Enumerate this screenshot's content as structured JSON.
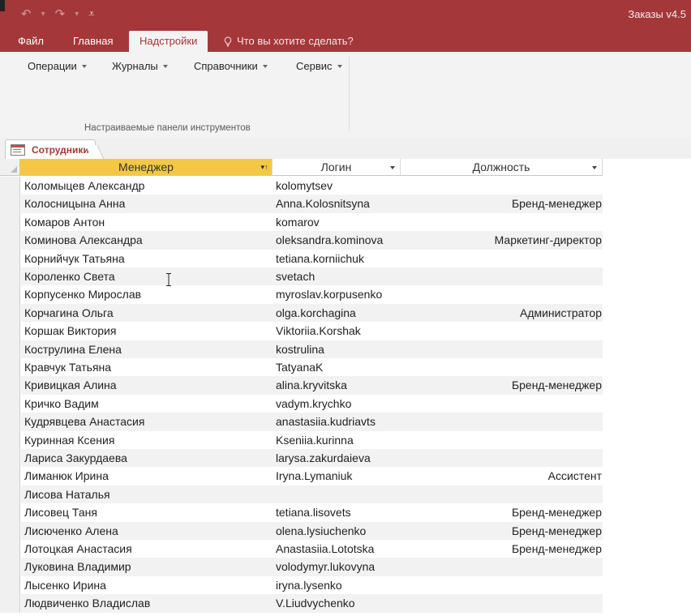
{
  "window": {
    "title": "Заказы v4.5"
  },
  "ribbon": {
    "tabs": [
      {
        "label": "Файл",
        "active": false
      },
      {
        "label": "Главная",
        "active": false
      },
      {
        "label": "Надстройки",
        "active": true
      }
    ],
    "tell_me": "Что вы хотите сделать?",
    "buttons": [
      "Операции",
      "Журналы",
      "Справочники",
      "Сервис"
    ],
    "group_label": "Настраиваемые панели инструментов"
  },
  "document_tab": {
    "label": "Сотрудники"
  },
  "table": {
    "columns": [
      "Менеджер",
      "Логин",
      "Должность"
    ],
    "sorted_column": "Менеджер",
    "rows": [
      [
        "Коломыцев  Александр",
        "kolomytsev",
        ""
      ],
      [
        "Колосницына Анна",
        "Anna.Kolosnitsyna",
        "Бренд-менеджер"
      ],
      [
        "Комаров Антон",
        "komarov",
        ""
      ],
      [
        "Коминова Александра",
        "oleksandra.kominova",
        "Маркетинг-директор"
      ],
      [
        "Корнийчук Татьяна",
        "tetiana.korniichuk",
        ""
      ],
      [
        "Короленко Света",
        "svetach",
        ""
      ],
      [
        "Корпусенко Мирослав",
        "myroslav.korpusenko",
        ""
      ],
      [
        "Корчагина Ольга",
        "olga.korchagina",
        "Администратор"
      ],
      [
        "Коршак Виктория",
        "Viktoriia.Korshak",
        ""
      ],
      [
        "Кострулина Елена",
        "kostrulina",
        ""
      ],
      [
        "Кравчук Татьяна",
        "TatyanaK",
        ""
      ],
      [
        "Кривицкая Алина",
        "alina.kryvitska",
        "Бренд-менеджер"
      ],
      [
        "Кричко Вадим",
        "vadym.krychko",
        ""
      ],
      [
        "Кудрявцева Анастасия",
        "anastasiia.kudriavts",
        ""
      ],
      [
        "Куринная Ксения",
        "Kseniia.kurinna",
        ""
      ],
      [
        "Лариса Закурдаева",
        "larysa.zakurdaieva",
        ""
      ],
      [
        "Лиманюк Ирина",
        "Iryna.Lymaniuk",
        "Ассистент"
      ],
      [
        "Лисова Наталья",
        "",
        ""
      ],
      [
        "Лисовец Таня",
        "tetiana.lisovets",
        "Бренд-менеджер"
      ],
      [
        "Лисюченко Алена",
        "olena.lysiuchenko",
        "Бренд-менеджер"
      ],
      [
        "Лотоцкая Анастасия",
        "Anastasiia.Lototska",
        "Бренд-менеджер"
      ],
      [
        "Луковина Владимир",
        "volodymyr.lukovyna",
        ""
      ],
      [
        "Лысенко Ирина",
        "iryna.lysenko",
        ""
      ],
      [
        "Людвиченко Владислав",
        "V.Liudvychenko",
        ""
      ]
    ]
  },
  "colors": {
    "accent": "#a4373a",
    "sorted_header": "#f4c842"
  }
}
